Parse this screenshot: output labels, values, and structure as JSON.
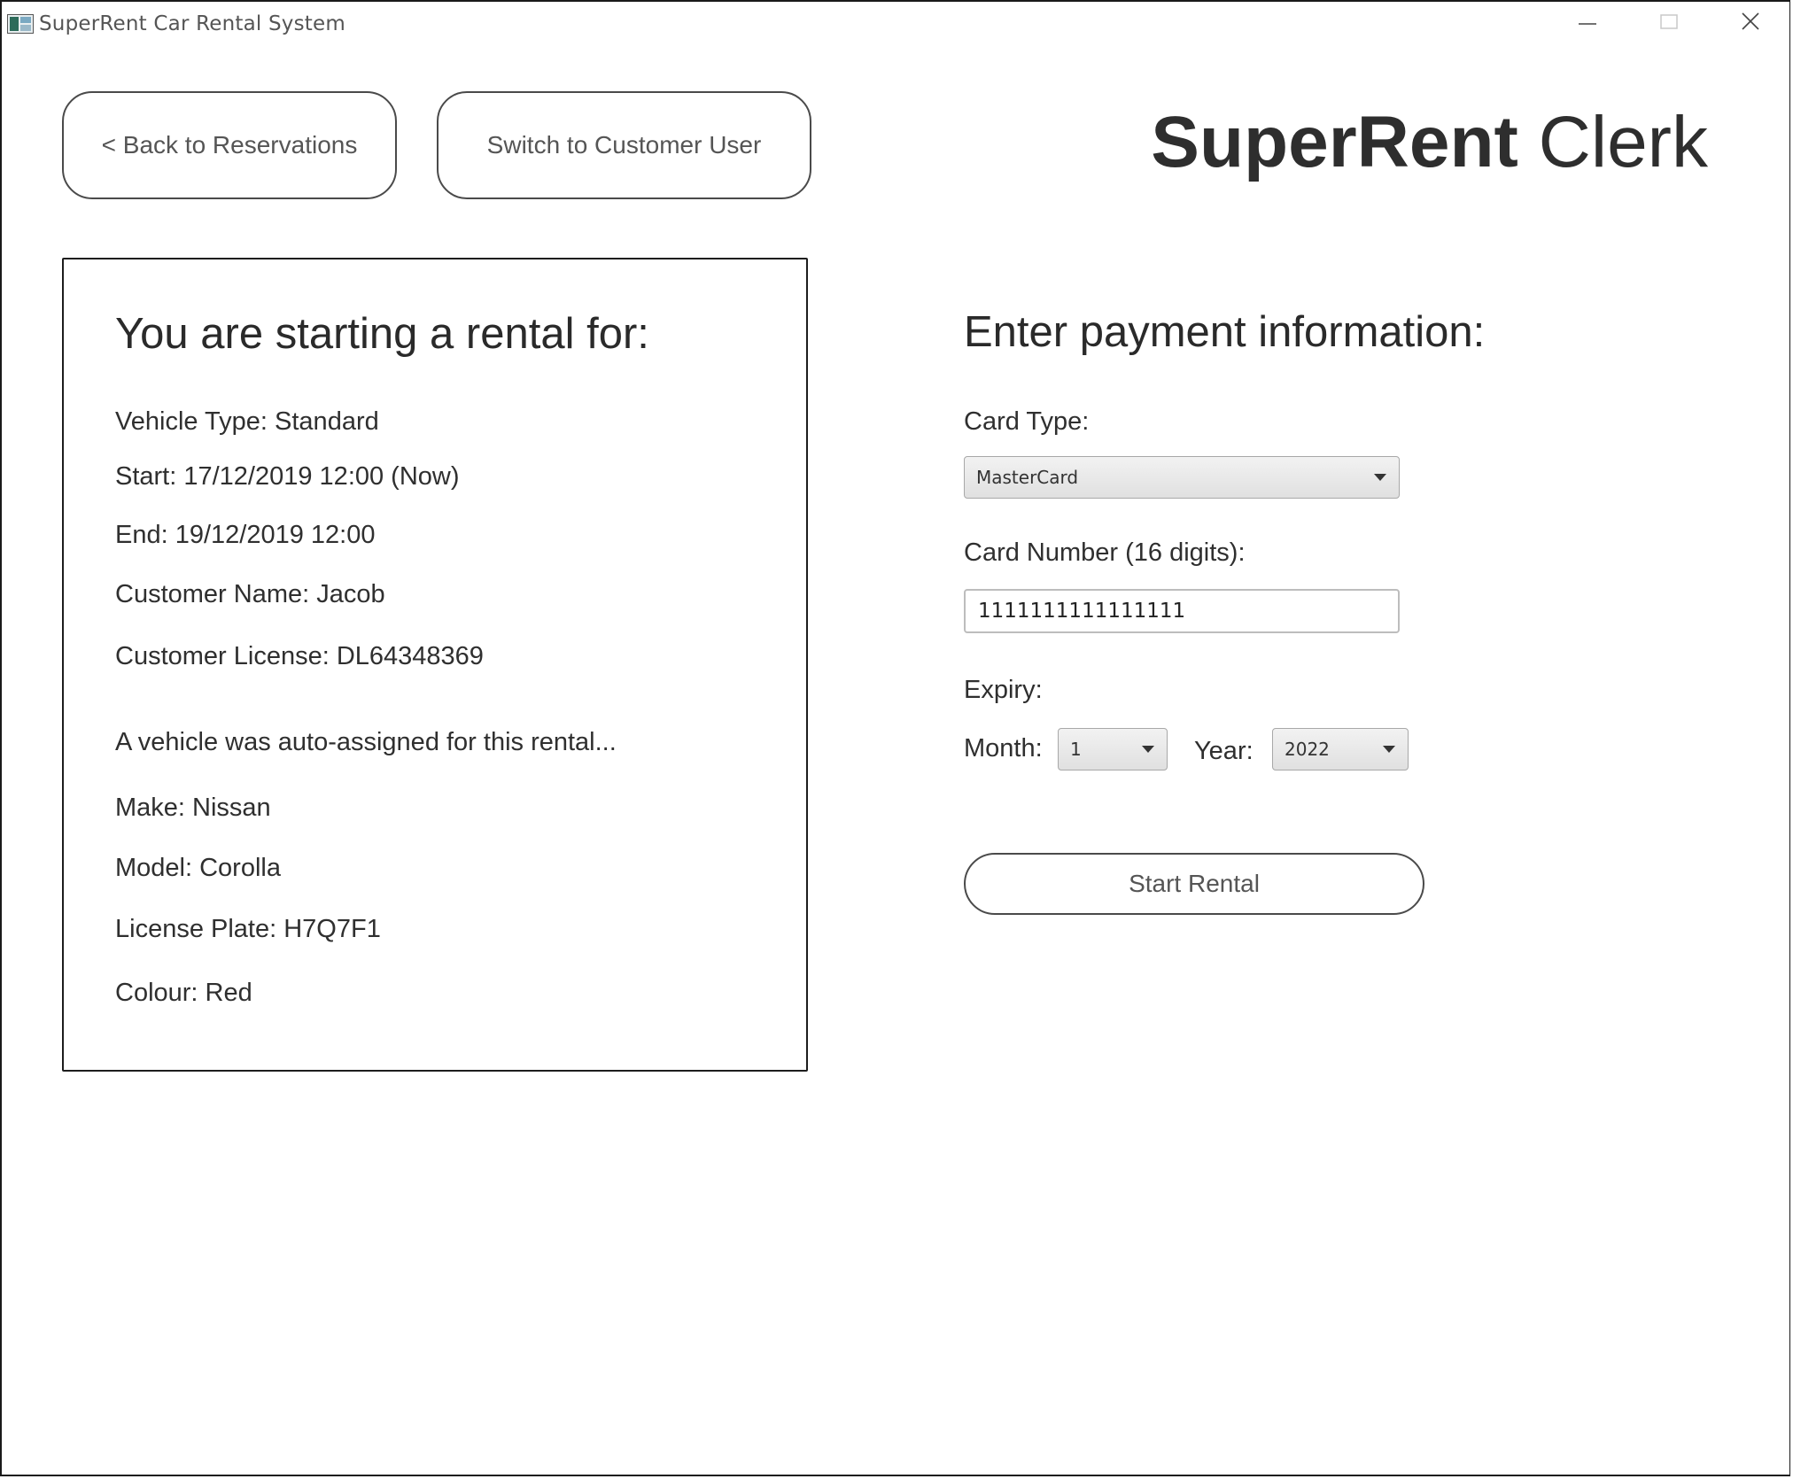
{
  "window": {
    "title": "SuperRent Car Rental System"
  },
  "header": {
    "back_label": "< Back to Reservations",
    "switch_label": "Switch to Customer User",
    "brand_bold": "SuperRent",
    "brand_rest": " Clerk"
  },
  "rental": {
    "heading": "You are starting a rental for:",
    "vehicle_type": "Vehicle Type: Standard",
    "start": "Start: 17/12/2019 12:00 (Now)",
    "end": "End: 19/12/2019 12:00",
    "customer_name": "Customer Name: Jacob",
    "customer_license": "Customer License: DL64348369",
    "auto_assigned": "A vehicle was auto-assigned for this rental...",
    "make": "Make: Nissan",
    "model": "Model: Corolla",
    "plate": "License Plate: H7Q7F1",
    "colour": "Colour: Red"
  },
  "payment": {
    "heading": "Enter payment information:",
    "card_type_label": "Card Type:",
    "card_type_value": "MasterCard",
    "card_number_label": "Card Number (16 digits):",
    "card_number_value": "1111111111111111",
    "expiry_label": "Expiry:",
    "month_label": "Month:",
    "month_value": "1",
    "year_label": "Year:",
    "year_value": "2022",
    "start_label": "Start Rental"
  }
}
